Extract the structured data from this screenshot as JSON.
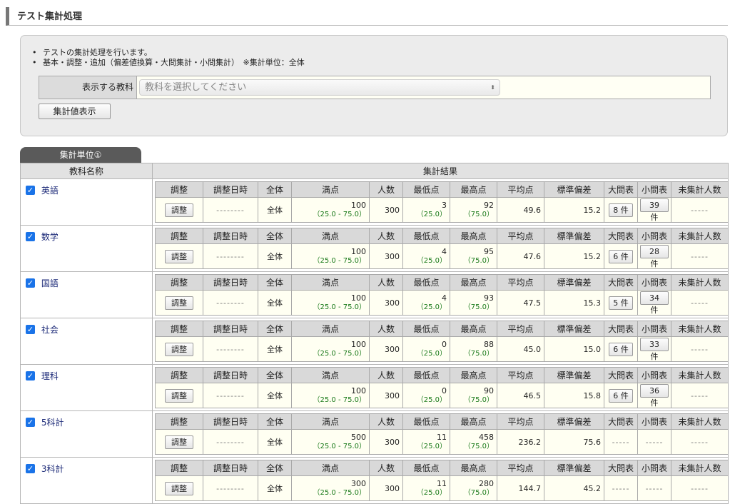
{
  "page_title": "テスト集計処理",
  "info": {
    "line1": "テストの集計処理を行います。",
    "line2": "基本・調整・追加（偏差値換算・大問集計・小問集計）　※集計単位：全体"
  },
  "subject_select": {
    "label": "表示する教科",
    "placeholder": "教科を選択してください",
    "arrow": "⬍"
  },
  "show_button": "集計値表示",
  "tab_label": "集計単位①",
  "outer_headers": {
    "subject": "教科名称",
    "result": "集計結果"
  },
  "inner_headers": [
    "調整",
    "調整日時",
    "全体",
    "満点",
    "人数",
    "最低点",
    "最高点",
    "平均点",
    "標準偏差",
    "大問表",
    "小問表",
    "未集計人数"
  ],
  "check_mark": "✓",
  "dash_long": "--------",
  "dash_short": "-----",
  "subjects": [
    {
      "name": "英語",
      "adjust": "調整",
      "datetime": "--------",
      "scope": "全体",
      "full": "100",
      "full_range": "（25.0 - 75.0）",
      "count": "300",
      "min": "3",
      "min_range": "（25.0）",
      "max": "92",
      "max_range": "（75.0）",
      "avg": "49.6",
      "sd": "15.2",
      "big": "8 件",
      "small": "39 件",
      "unagg": "-----"
    },
    {
      "name": "数学",
      "adjust": "調整",
      "datetime": "--------",
      "scope": "全体",
      "full": "100",
      "full_range": "（25.0 - 75.0）",
      "count": "300",
      "min": "4",
      "min_range": "（25.0）",
      "max": "95",
      "max_range": "（75.0）",
      "avg": "47.6",
      "sd": "15.2",
      "big": "6 件",
      "small": "28 件",
      "unagg": "-----"
    },
    {
      "name": "国語",
      "adjust": "調整",
      "datetime": "--------",
      "scope": "全体",
      "full": "100",
      "full_range": "（25.0 - 75.0）",
      "count": "300",
      "min": "4",
      "min_range": "（25.0）",
      "max": "93",
      "max_range": "（75.0）",
      "avg": "47.5",
      "sd": "15.3",
      "big": "5 件",
      "small": "34 件",
      "unagg": "-----"
    },
    {
      "name": "社会",
      "adjust": "調整",
      "datetime": "--------",
      "scope": "全体",
      "full": "100",
      "full_range": "（25.0 - 75.0）",
      "count": "300",
      "min": "0",
      "min_range": "（25.0）",
      "max": "88",
      "max_range": "（75.0）",
      "avg": "45.0",
      "sd": "15.0",
      "big": "6 件",
      "small": "33 件",
      "unagg": "-----"
    },
    {
      "name": "理科",
      "adjust": "調整",
      "datetime": "--------",
      "scope": "全体",
      "full": "100",
      "full_range": "（25.0 - 75.0）",
      "count": "300",
      "min": "0",
      "min_range": "（25.0）",
      "max": "90",
      "max_range": "（75.0）",
      "avg": "46.5",
      "sd": "15.8",
      "big": "6 件",
      "small": "36 件",
      "unagg": "-----"
    },
    {
      "name": "5科計",
      "adjust": "調整",
      "datetime": "--------",
      "scope": "全体",
      "full": "500",
      "full_range": "（25.0 - 75.0）",
      "count": "300",
      "min": "11",
      "min_range": "（25.0）",
      "max": "458",
      "max_range": "（75.0）",
      "avg": "236.2",
      "sd": "75.6",
      "big": "-----",
      "small": "-----",
      "unagg": "-----"
    },
    {
      "name": "3科計",
      "adjust": "調整",
      "datetime": "--------",
      "scope": "全体",
      "full": "300",
      "full_range": "（25.0 - 75.0）",
      "count": "300",
      "min": "11",
      "min_range": "（25.0）",
      "max": "280",
      "max_range": "（75.0）",
      "avg": "144.7",
      "sd": "45.2",
      "big": "-----",
      "small": "-----",
      "unagg": "-----"
    }
  ]
}
